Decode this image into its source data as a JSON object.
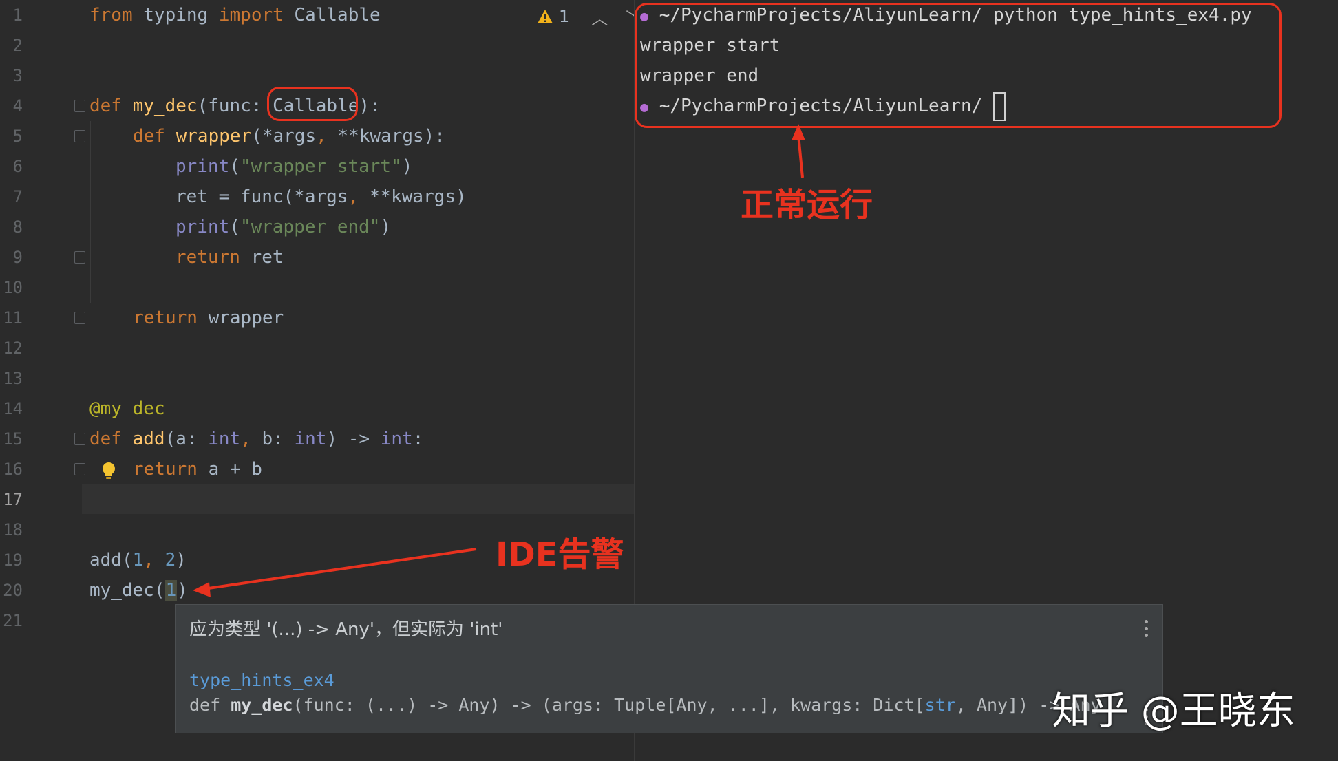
{
  "editor": {
    "line_numbers": [
      "1",
      "2",
      "3",
      "4",
      "5",
      "6",
      "7",
      "8",
      "9",
      "10",
      "11",
      "12",
      "13",
      "14",
      "15",
      "16",
      "17",
      "18",
      "19",
      "20",
      "21"
    ],
    "current_line": "17",
    "code": {
      "l1": {
        "a": "from",
        "b": " typing ",
        "c": "import",
        "d": " Callable"
      },
      "l4": {
        "a": "def",
        "b": " ",
        "c": "my_dec",
        "d": "(func: ",
        "e": "Callable",
        "f": "):"
      },
      "l5": {
        "a": "def",
        "b": " ",
        "c": "wrapper",
        "d": "(*args",
        "e": ",",
        "f": " **kwargs):"
      },
      "l6": {
        "a": "print",
        "b": "(",
        "c": "\"wrapper start\"",
        "d": ")"
      },
      "l7": {
        "a": "ret = func(*args",
        "b": ",",
        "c": " **kwargs)"
      },
      "l8": {
        "a": "print",
        "b": "(",
        "c": "\"wrapper end\"",
        "d": ")"
      },
      "l9": {
        "a": "return",
        "b": " ret"
      },
      "l11": {
        "a": "return",
        "b": " wrapper"
      },
      "l14": {
        "a": "@my_dec"
      },
      "l15": {
        "a": "def",
        "b": " ",
        "c": "add",
        "d": "(a: ",
        "e": "int",
        "f": ",",
        "g": " b: ",
        "h": "int",
        "i": ") -> ",
        "j": "int",
        "k": ":"
      },
      "l16": {
        "a": "return",
        "b": " a + b"
      },
      "l19": {
        "a": "add(",
        "b": "1",
        "c": ",",
        "d": " ",
        "e": "2",
        "f": ")"
      },
      "l20": {
        "a": "my_dec(",
        "b": "1",
        "c": ")"
      }
    },
    "warning_count": "1",
    "warning_icon": "warning-triangle-icon",
    "hint_icon": "lightbulb-icon"
  },
  "terminal": {
    "lines": [
      {
        "prompt": "~/PycharmProjects/AliyunLearn/",
        "cmd": " python type_hints_ex4.py"
      },
      {
        "text": "wrapper start"
      },
      {
        "text": "wrapper end"
      },
      {
        "prompt": "~/PycharmProjects/AliyunLearn/",
        "cmd": " "
      }
    ],
    "prompt_icon": "apple-icon"
  },
  "annotations": {
    "normal_run": "正常运行",
    "ide_warning": "IDE告警",
    "color": "#e8321f"
  },
  "popup": {
    "message": "应为类型 '(...) -> Any'，但实际为 'int'",
    "module": "type_hints_ex4",
    "signature_prefix": "def ",
    "signature_name": "my_dec",
    "signature_mid": "(func: (...) -> Any) -> (args: Tuple[Any, ...], kwargs: Dict[",
    "signature_type": "str",
    "signature_tail": ", Any]) -> Any"
  },
  "watermark": "知乎 @王晓东",
  "colors": {
    "background": "#2b2b2b",
    "keyword": "#cc7832",
    "function": "#ffc66d",
    "builtin": "#8888c6",
    "string": "#6a8759",
    "number": "#6897bb",
    "decorator": "#bbb529"
  }
}
